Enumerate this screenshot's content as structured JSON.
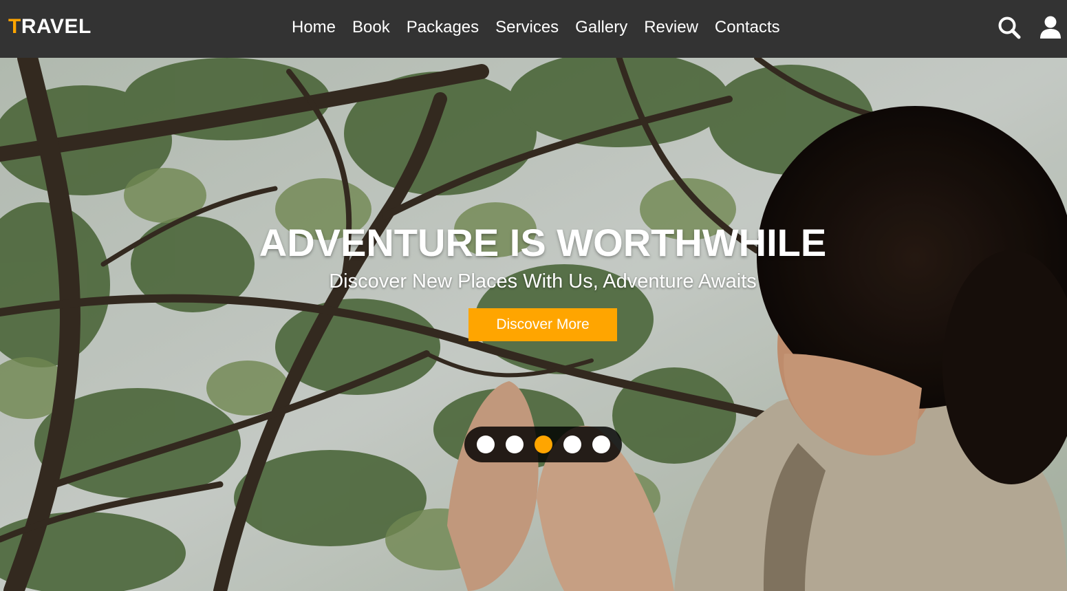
{
  "nav": {
    "logo_first": "T",
    "logo_rest": "RAVEL",
    "links": [
      "Home",
      "Book",
      "Packages",
      "Services",
      "Gallery",
      "Review",
      "Contacts"
    ],
    "icons": [
      "search-icon",
      "user-icon"
    ]
  },
  "hero": {
    "title": "ADVENTURE IS WORTHWHILE",
    "subtitle": "Discover New Places With Us, Adventure Awaits",
    "cta_label": "Discover More"
  },
  "slider": {
    "total": 5,
    "active_index": 2
  },
  "colors": {
    "accent": "#ffa500",
    "navbar": "#333333"
  }
}
